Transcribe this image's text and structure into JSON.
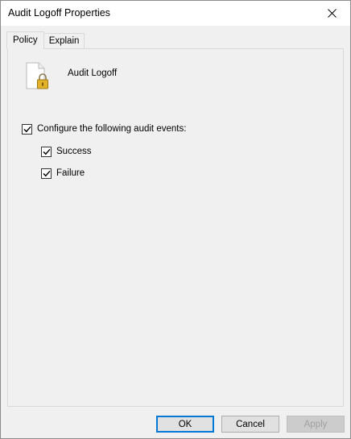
{
  "window": {
    "title": "Audit Logoff Properties"
  },
  "tabs": [
    {
      "label": "Policy",
      "active": true
    },
    {
      "label": "Explain",
      "active": false
    }
  ],
  "policy": {
    "name": "Audit Logoff",
    "icon": "document-lock-icon"
  },
  "options": {
    "configure": {
      "label": "Configure the following audit events:",
      "checked": true
    },
    "success": {
      "label": "Success",
      "checked": true
    },
    "failure": {
      "label": "Failure",
      "checked": true
    }
  },
  "buttons": {
    "ok": "OK",
    "cancel": "Cancel",
    "apply": "Apply"
  },
  "colors": {
    "default_button_border": "#0078d7",
    "dialog_background": "#f0f0f0"
  }
}
